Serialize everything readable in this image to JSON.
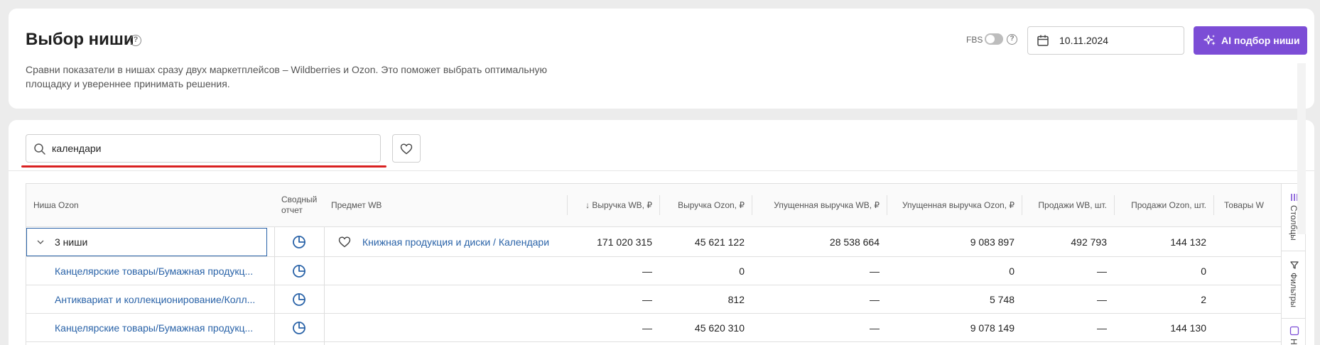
{
  "header": {
    "title": "Выбор ниши",
    "description_line1": "Сравни показатели в нишах сразу двух маркетплейсов – Wildberries и Ozon. Это поможет выбрать оптимальную",
    "description_line2": "площадку и увереннее принимать решения.",
    "fbs_label": "FBS",
    "fbs_enabled": false,
    "date": "10.11.2024",
    "ai_button": "AI подбор ниши",
    "accent_color": "#7c4dd6"
  },
  "search": {
    "value": "календари"
  },
  "table": {
    "columns": {
      "niche_ozon": "Ниша Ozon",
      "summary_line1": "Сводный",
      "summary_line2": "отчет",
      "subject_wb": "Предмет WB",
      "revenue_wb": "↓ Выручка WB, ₽",
      "revenue_ozon": "Выручка Ozon, ₽",
      "lost_revenue_wb": "Упущенная выручка WB, ₽",
      "lost_revenue_ozon": "Упущенная выручка Ozon, ₽",
      "sales_wb": "Продажи WB, шт.",
      "sales_ozon": "Продажи Ozon, шт.",
      "goods": "Товары W"
    },
    "group_row": {
      "niche": "3 ниши",
      "subject": "Книжная продукция и диски / Календари",
      "revenue_wb": "171 020 315",
      "revenue_ozon": "45 621 122",
      "lost_revenue_wb": "28 538 664",
      "lost_revenue_ozon": "9 083 897",
      "sales_wb": "492 793",
      "sales_ozon": "144 132"
    },
    "rows": [
      {
        "niche": "Канцелярские товары/Бумажная продукц...",
        "revenue_wb": "—",
        "revenue_ozon": "0",
        "lost_revenue_wb": "—",
        "lost_revenue_ozon": "0",
        "sales_wb": "—",
        "sales_ozon": "0"
      },
      {
        "niche": "Антиквариат и коллекционирование/Колл...",
        "revenue_wb": "—",
        "revenue_ozon": "812",
        "lost_revenue_wb": "—",
        "lost_revenue_ozon": "5 748",
        "sales_wb": "—",
        "sales_ozon": "2"
      },
      {
        "niche": "Канцелярские товары/Бумажная продукц...",
        "revenue_wb": "—",
        "revenue_ozon": "45 620 310",
        "lost_revenue_wb": "—",
        "lost_revenue_ozon": "9 078 149",
        "sales_wb": "—",
        "sales_ozon": "144 130"
      }
    ]
  },
  "side_panel": {
    "columns_tab": "Столбцы",
    "filters_tab": "Фильтры",
    "third_tab": "Н"
  }
}
